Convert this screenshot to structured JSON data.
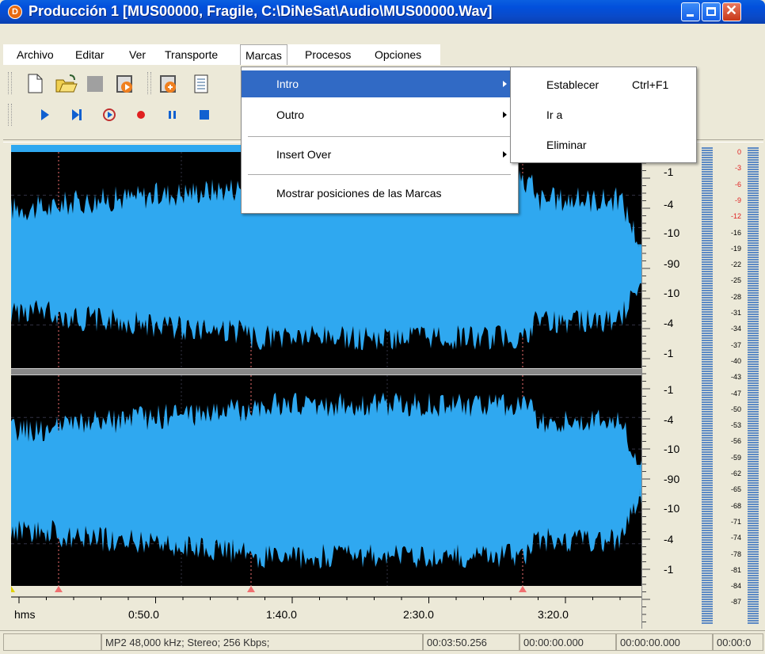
{
  "window": {
    "title": "Producción 1 [MUS00000, Fragile, C:\\DiNeSat\\Audio\\MUS00000.Wav]",
    "icon": "D"
  },
  "menubar": [
    "Archivo",
    "Editar",
    "Ver",
    "Transporte",
    "Marcas",
    "Procesos",
    "Opciones"
  ],
  "dropdown": {
    "items": [
      {
        "label": "Intro",
        "submenu": true,
        "highlighted": true
      },
      {
        "label": "Outro",
        "submenu": true
      },
      {
        "label": "Insert Over",
        "submenu": true
      },
      {
        "label": "Mostrar posiciones de las Marcas",
        "submenu": false
      }
    ]
  },
  "submenu": {
    "items": [
      {
        "label": "Establecer",
        "shortcut": "Ctrl+F1"
      },
      {
        "label": "Ir a",
        "shortcut": ""
      },
      {
        "label": "Eliminar",
        "shortcut": ""
      }
    ]
  },
  "channel1_db": [
    "-1",
    "-4",
    "-10",
    "-90",
    "-10",
    "-4",
    "-1"
  ],
  "channel2_db": [
    "-1",
    "-4",
    "-10",
    "-90",
    "-10",
    "-4",
    "-1"
  ],
  "vu_labels": [
    "0",
    "-3",
    "-6",
    "-9",
    "-12",
    "-16",
    "-19",
    "-22",
    "-25",
    "-28",
    "-31",
    "-34",
    "-37",
    "-40",
    "-43",
    "-47",
    "-50",
    "-53",
    "-56",
    "-59",
    "-62",
    "-65",
    "-68",
    "-71",
    "-74",
    "-78",
    "-81",
    "-84",
    "-87"
  ],
  "timeline": {
    "unit": "hms",
    "labels": [
      "0:50.0",
      "1:40.0",
      "2:30.0",
      "3:20.0"
    ]
  },
  "status": {
    "format": "MP2 48,000 kHz; Stereo;  256 Kbps;",
    "duration": "00:03:50.256",
    "pos1": "00:00:00.000",
    "pos2": "00:00:00.000",
    "pos3": "00:00:0"
  },
  "colors": {
    "waveform": "#2FA8F0",
    "marker": "#F07070",
    "highlight": "#316AC5",
    "vu_hot": "#E02020"
  },
  "icons": {
    "new": "new-file-icon",
    "open": "open-folder-icon",
    "stop": "stop-gray-icon",
    "play": "play-icon",
    "play_to_end": "play-to-end-icon",
    "loop": "loop-play-icon",
    "record": "record-icon",
    "pause": "pause-icon",
    "stop_blue": "stop-icon"
  }
}
